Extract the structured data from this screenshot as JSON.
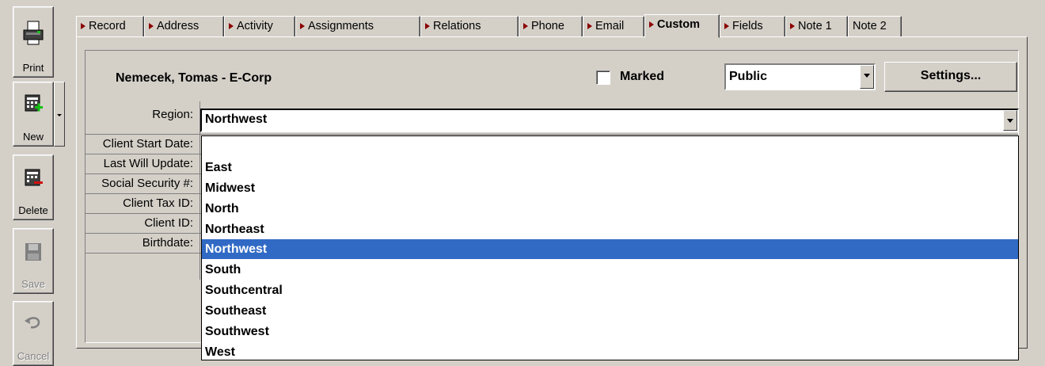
{
  "toolbar": {
    "print": "Print",
    "new": "New",
    "delete": "Delete",
    "save": "Save",
    "cancel": "Cancel"
  },
  "tabs": [
    "Record",
    "Address",
    "Activity",
    "Assignments",
    "Relations",
    "Phone",
    "Email",
    "Custom",
    "Fields",
    "Note 1",
    "Note 2"
  ],
  "header": {
    "contact_name": "Nemecek, Tomas - E-Corp",
    "marked_label": "Marked",
    "visibility_value": "Public",
    "settings_label": "Settings..."
  },
  "fields": [
    {
      "label": "Region:",
      "value": "Northwest"
    },
    {
      "label": "Client Start Date:"
    },
    {
      "label": "Last Will Update:"
    },
    {
      "label": "Social Security #:"
    },
    {
      "label": "Client Tax ID:"
    },
    {
      "label": "Client ID:"
    },
    {
      "label": "Birthdate:"
    }
  ],
  "dropdown": {
    "options": [
      "",
      "East",
      "Midwest",
      "North",
      "Northeast",
      "Northwest",
      "South",
      "Southcentral",
      "Southeast",
      "Southwest",
      "West"
    ],
    "selected": "Northwest"
  },
  "colors": {
    "selection": "#316ac5",
    "tab_marker": "#8a0000"
  }
}
